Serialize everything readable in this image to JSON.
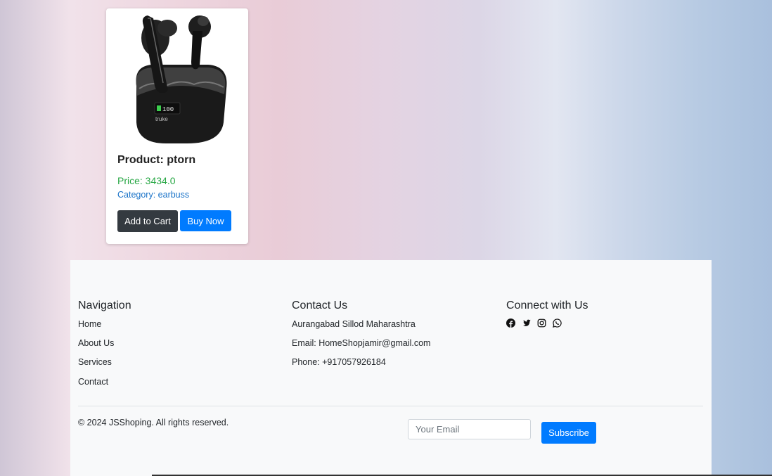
{
  "product": {
    "title": "Product: ptorn",
    "price": "Price: 3434.0",
    "category": "Category: earbuss",
    "add_to_cart_label": "Add to Cart",
    "buy_now_label": "Buy Now",
    "image_text": "truke",
    "image_battery": "100"
  },
  "footer": {
    "navigation": {
      "title": "Navigation",
      "items": [
        "Home",
        "About Us",
        "Services",
        "Contact"
      ]
    },
    "contact": {
      "title": "Contact Us",
      "address": "Aurangabad Sillod Maharashtra",
      "email": "Email: HomeShopjamir@gmail.com",
      "phone": "Phone: +917057926184"
    },
    "connect": {
      "title": "Connect with Us",
      "icons": [
        "facebook-icon",
        "twitter-icon",
        "instagram-icon",
        "whatsapp-icon"
      ]
    },
    "copyright": "© 2024 JSShoping. All rights reserved.",
    "subscribe": {
      "placeholder": "Your Email",
      "button_label": "Subscribe"
    }
  },
  "colors": {
    "primary": "#007bff",
    "dark": "#343a40",
    "price_green": "#28a745",
    "category_blue": "#1a73c8"
  }
}
